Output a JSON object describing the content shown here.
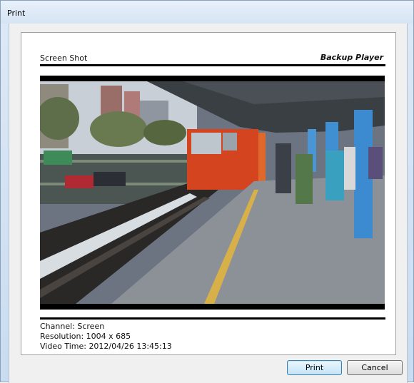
{
  "window": {
    "title": "Print"
  },
  "page": {
    "header_left": "Screen Shot",
    "header_right": "Backup Player",
    "channel": "Channel: Screen",
    "resolution": "Resolution: 1004 x 685",
    "video_time": "Video Time: 2012/04/26 13:45:13"
  },
  "buttons": {
    "print": "Print",
    "cancel": "Cancel"
  }
}
